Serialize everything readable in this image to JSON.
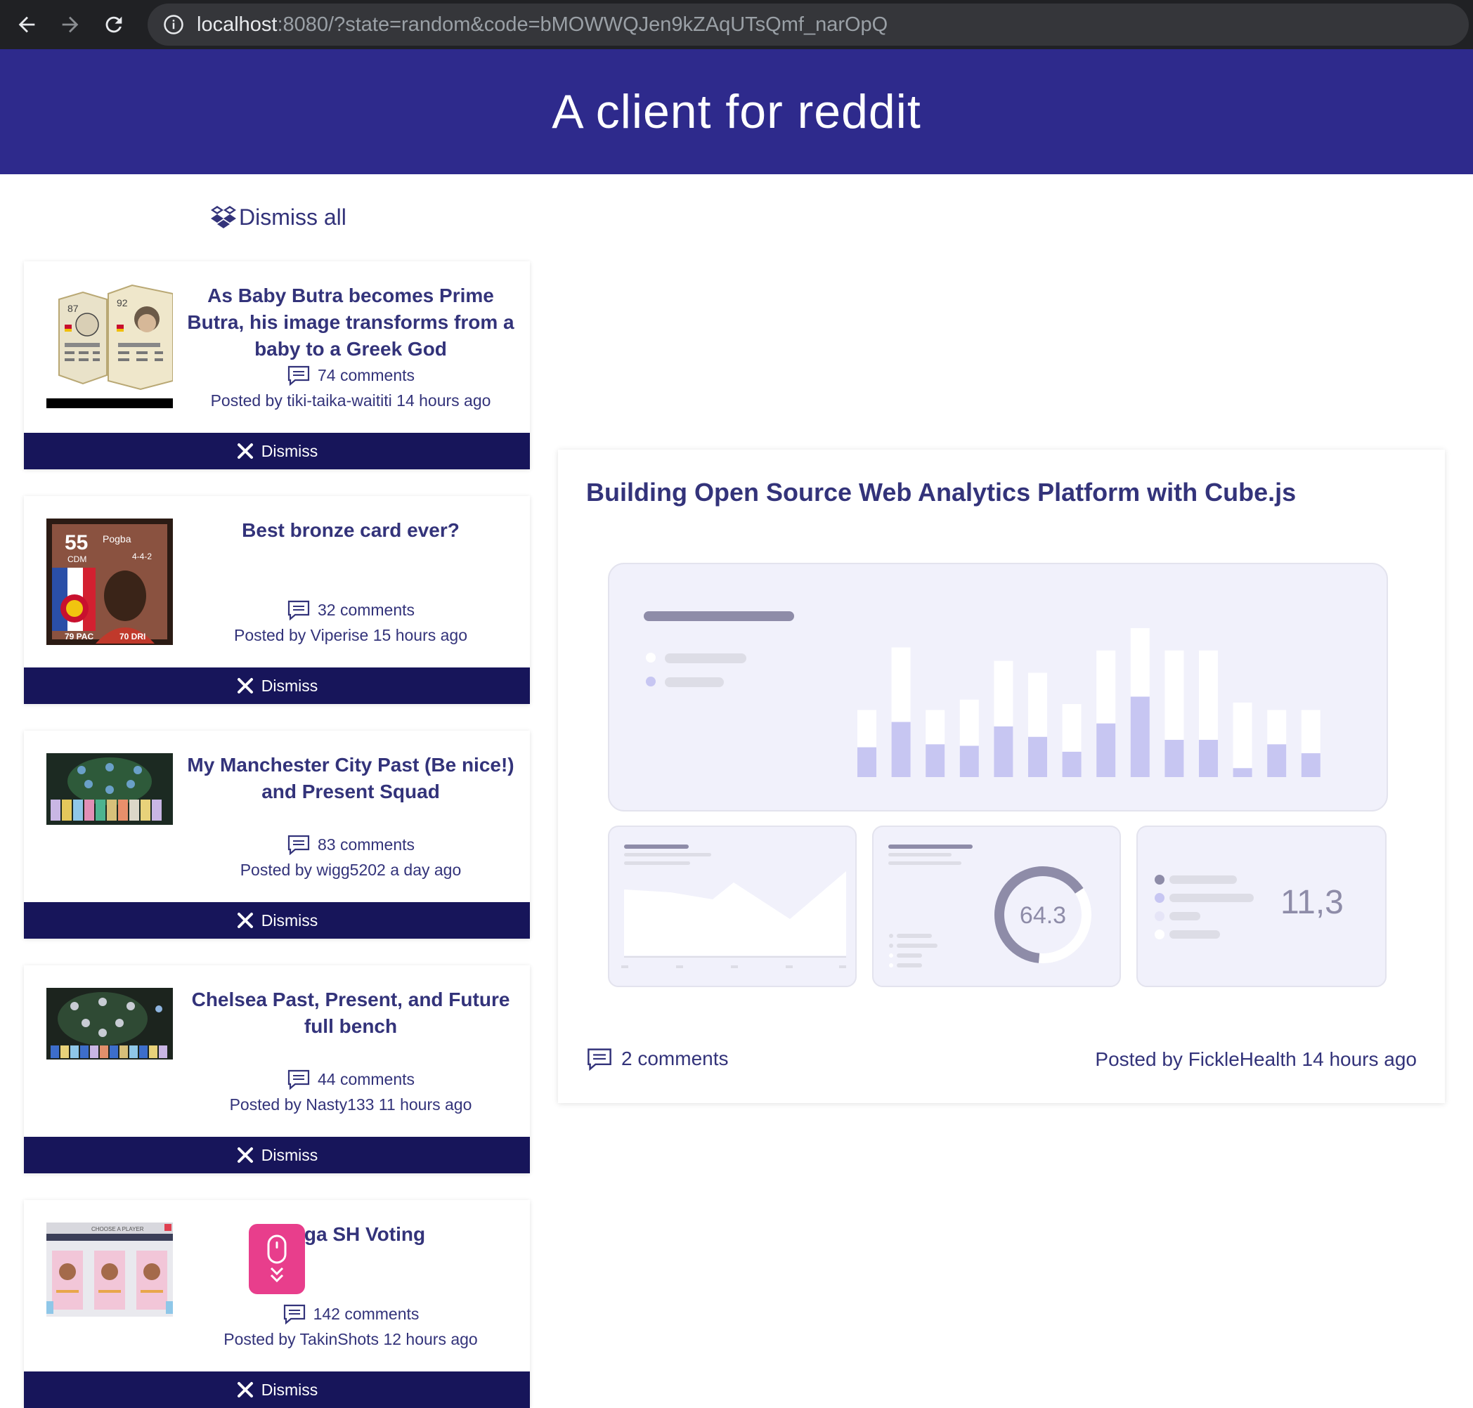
{
  "browser": {
    "url_host": "localhost",
    "url_rest": ":8080/?state=random&code=bMOWWQJen9kZAqUTsQmf_narOpQ"
  },
  "header": {
    "title": "A client for reddit"
  },
  "dismiss_all_label": "Dismiss all",
  "dismiss_label": "Dismiss",
  "posts": [
    {
      "title": "As Baby Butra becomes Prime Butra, his image transforms from a baby to a Greek God",
      "comments": "74 comments",
      "meta": "Posted by tiki-taika-waititi 14 hours ago",
      "thumb_card_left": "87",
      "thumb_card_right": "92"
    },
    {
      "title": "Best bronze card ever?",
      "comments": "32 comments",
      "meta": "Posted by Viperise 15 hours ago",
      "thumb_rating": "55",
      "thumb_name": "Pogba",
      "thumb_pos": "CDM",
      "thumb_formation": "4-4-2",
      "thumb_stat1": "79 PAC",
      "thumb_stat2": "70 DRI"
    },
    {
      "title": "My Manchester City Past (Be nice!) and Present Squad",
      "comments": "83 comments",
      "meta": "Posted by wigg5202 a day ago"
    },
    {
      "title": "Chelsea Past, Present, and Future full bench",
      "comments": "44 comments",
      "meta": "Posted by Nasty133 11 hours ago"
    },
    {
      "title": "ga SH Voting",
      "comments": "142 comments",
      "meta": "Posted by TakinShots 12 hours ago",
      "thumb_header": "CHOOSE A PLAYER"
    }
  ],
  "detail": {
    "title": "Building Open Source Web Analytics Platform with Cube.js",
    "comments": "2 comments",
    "meta": "Posted by FickleHealth 14 hours ago",
    "image": {
      "donut_value": "64.3",
      "kpi_value": "11,3",
      "bars": [
        {
          "total": 0.45,
          "value": 0.2
        },
        {
          "total": 0.87,
          "value": 0.37
        },
        {
          "total": 0.45,
          "value": 0.22
        },
        {
          "total": 0.52,
          "value": 0.21
        },
        {
          "total": 0.78,
          "value": 0.34
        },
        {
          "total": 0.7,
          "value": 0.27
        },
        {
          "total": 0.49,
          "value": 0.17
        },
        {
          "total": 0.85,
          "value": 0.36
        },
        {
          "total": 1.0,
          "value": 0.54
        },
        {
          "total": 0.85,
          "value": 0.25
        },
        {
          "total": 0.85,
          "value": 0.25
        },
        {
          "total": 0.5,
          "value": 0.06
        },
        {
          "total": 0.45,
          "value": 0.22
        },
        {
          "total": 0.45,
          "value": 0.16
        }
      ]
    }
  },
  "colors": {
    "header_bg": "#2e2a8c",
    "dismiss_bg": "#17155a",
    "text": "#33337a",
    "accent_pink": "#e83e8c"
  }
}
